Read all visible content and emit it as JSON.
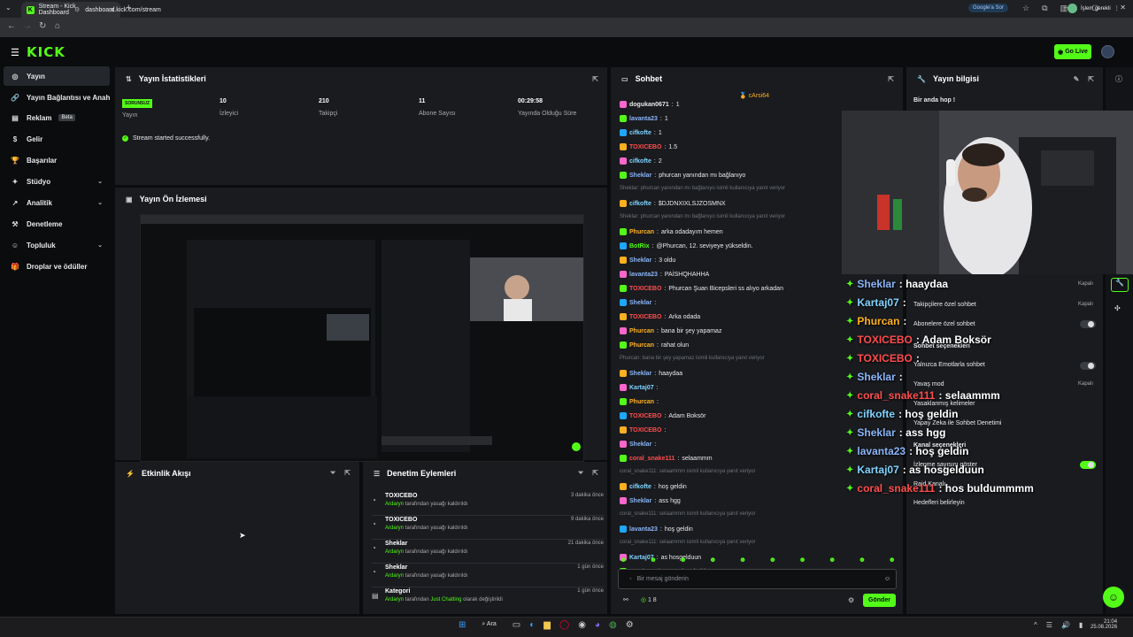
{
  "browser": {
    "tab_title": "Stream - Kick Dashboard",
    "url": "dashboard.kick.com/stream",
    "google_btn": "Google'a Sor",
    "paused": "İşlem gerekli"
  },
  "header": {
    "logo": "KICK",
    "go_live": "Go Live"
  },
  "sidebar": {
    "items": [
      {
        "label": "Yayın",
        "icon": "radio-icon"
      },
      {
        "label": "Yayın Bağlantısı ve Anahtarı",
        "icon": "link-icon"
      },
      {
        "label": "Reklam",
        "icon": "ad-icon",
        "badge": "Beta"
      },
      {
        "label": "Gelir",
        "icon": "money-icon"
      },
      {
        "label": "Başarılar",
        "icon": "trophy-icon"
      },
      {
        "label": "Stüdyo",
        "icon": "studio-icon"
      },
      {
        "label": "Analitik",
        "icon": "chart-icon"
      },
      {
        "label": "Denetleme",
        "icon": "hammer-icon"
      },
      {
        "label": "Topluluk",
        "icon": "community-icon"
      },
      {
        "label": "Droplar ve ödüller",
        "icon": "gift-icon"
      }
    ]
  },
  "stats": {
    "title": "Yayın İstatistikleri",
    "status_badge": "SORUNSUZ",
    "status_label": "Yayın",
    "items": [
      {
        "value": "10",
        "label": "İzleyici"
      },
      {
        "value": "210",
        "label": "Takipçi"
      },
      {
        "value": "11",
        "label": "Abone Sayısı"
      },
      {
        "value": "00:29:58",
        "label": "Yayında Olduğu Süre"
      }
    ],
    "success": "Stream started successfully."
  },
  "preview": {
    "title": "Yayın Ön İzlemesi"
  },
  "activity": {
    "title": "Etkinlik Akışı"
  },
  "mod_actions": {
    "title": "Denetim Eylemleri",
    "items": [
      {
        "name": "TOXICEBO",
        "by": "Ardaryn",
        "text": "tarafından yasağı kaldırıldı",
        "time": "3 dakika önce"
      },
      {
        "name": "TOXICEBO",
        "by": "Ardaryn",
        "text": "tarafından yasağı kaldırıldı",
        "time": "9 dakika önce"
      },
      {
        "name": "Sheklar",
        "by": "Ardaryn",
        "text": "tarafından yasağı kaldırıldı",
        "time": "21 dakika önce"
      },
      {
        "name": "Sheklar",
        "by": "Ardaryn",
        "text": "tarafından yasağı kaldırıldı",
        "time": "1 gün önce"
      },
      {
        "name": "Kategori",
        "by": "Ardaryn",
        "text": "tarafından",
        "extra": "Just Chatting",
        "text2": "olarak değiştirildi",
        "time": "1 gün önce"
      }
    ]
  },
  "chat": {
    "title": "Sohbet",
    "pinned": "cArsi64",
    "messages": [
      {
        "user": "dogukan0671",
        "text": "1",
        "color": "#e7e9ea"
      },
      {
        "user": "lavanta23",
        "text": "1",
        "color": "#8ab4f8"
      },
      {
        "user": "cifkofte",
        "text": "1",
        "color": "#7fd3ff"
      },
      {
        "user": "TOXICEBO",
        "text": "1.5",
        "color": "#ff4d4d"
      },
      {
        "user": "cifkofte",
        "text": "2",
        "color": "#7fd3ff"
      },
      {
        "user": "Sheklar",
        "text": "phurcan yanından mı bağlanıyo",
        "color": "#8ab4f8"
      },
      {
        "sys": "Sheklar: phurcan yanından mı bağlanıyo isimli kullanıcıya yanıt veriyor"
      },
      {
        "user": "cifkofte",
        "text": "$DJDNXIXLSJZOSMNX",
        "color": "#7fd3ff"
      },
      {
        "sys": "Sheklar: phurcan yanından mı bağlanıyo isimli kullanıcıya yanıt veriyor"
      },
      {
        "user": "Phurcan",
        "text": "arka odadayım hemen",
        "color": "#ffb020"
      },
      {
        "user": "BotRix",
        "text": "@Phurcan, 12. seviyeye yükseldin.",
        "color": "#53fc18"
      },
      {
        "user": "Sheklar",
        "text": "3 oldu",
        "color": "#8ab4f8"
      },
      {
        "user": "lavanta23",
        "text": "PAİSHQHAHHA",
        "color": "#8ab4f8"
      },
      {
        "user": "TOXICEBO",
        "text": "Phurcan Şuan Bicepsleri ss alıyo arkadan",
        "color": "#ff4d4d"
      },
      {
        "user": "Sheklar",
        "text": "",
        "color": "#8ab4f8"
      },
      {
        "user": "TOXICEBO",
        "text": "Arka odada",
        "color": "#ff4d4d"
      },
      {
        "user": "Phurcan",
        "text": "bana bir şey yapamaz",
        "color": "#ffb020"
      },
      {
        "user": "Phurcan",
        "text": "rahat olun",
        "color": "#ffb020"
      },
      {
        "sys": "Phurcan: bana bir şey yapamaz isimli kullanıcıya yanıt veriyor"
      },
      {
        "user": "Sheklar",
        "text": "haaydaa",
        "color": "#8ab4f8"
      },
      {
        "user": "Kartaj07",
        "text": "",
        "color": "#7fd3ff"
      },
      {
        "user": "Phurcan",
        "text": "",
        "color": "#ffb020"
      },
      {
        "user": "TOXICEBO",
        "text": "Adam Boksör",
        "color": "#ff4d4d"
      },
      {
        "user": "TOXICEBO",
        "text": "",
        "color": "#ff4d4d"
      },
      {
        "user": "Sheklar",
        "text": "",
        "color": "#8ab4f8"
      },
      {
        "user": "coral_snake111",
        "text": "selaammm",
        "color": "#ff4d4d"
      },
      {
        "sys": "coral_snake111: selaammm isimli kullanıcıya yanıt veriyor"
      },
      {
        "user": "cifkofte",
        "text": "hoş geldin",
        "color": "#7fd3ff"
      },
      {
        "user": "Sheklar",
        "text": "ass hgg",
        "color": "#8ab4f8"
      },
      {
        "sys": "coral_snake111: selaammm isimli kullanıcıya yanıt veriyor"
      },
      {
        "user": "lavanta23",
        "text": "hoş geldin",
        "color": "#8ab4f8"
      },
      {
        "sys": "coral_snake111: selaammm isimli kullanıcıya yanıt veriyor"
      },
      {
        "user": "Kartaj07",
        "text": "as hosgelduun",
        "color": "#7fd3ff"
      },
      {
        "user": "coral_snake111",
        "text": "hos buldummmm",
        "color": "#ff4d4d"
      }
    ],
    "input_placeholder": "Bir mesaj gönderin",
    "viewer_count": "1 8",
    "send": "Gönder"
  },
  "info": {
    "title": "Yayın bilgisi",
    "stream_title": "Bir anda hop !"
  },
  "overlay": [
    {
      "user": "Sheklar",
      "text": ": haaydaa",
      "color": "#8ab4f8"
    },
    {
      "user": "Kartaj07",
      "text": ":",
      "color": "#7fd3ff"
    },
    {
      "user": "Phurcan",
      "text": ":",
      "color": "#ffb020"
    },
    {
      "user": "TOXICEBO",
      "text": ": Adam Boksör",
      "color": "#ff4d4d"
    },
    {
      "user": "TOXICEBO",
      "text": ":",
      "color": "#ff4d4d"
    },
    {
      "user": "Sheklar",
      "text": ":",
      "color": "#8ab4f8"
    },
    {
      "user": "coral_snake111",
      "text": ": selaammm",
      "color": "#ff4d4d"
    },
    {
      "user": "cifkofte",
      "text": ": hoş geldin",
      "color": "#7fd3ff"
    },
    {
      "user": "Sheklar",
      "text": ": ass hgg",
      "color": "#8ab4f8"
    },
    {
      "user": "lavanta23",
      "text": ": hoş geldin",
      "color": "#8ab4f8"
    },
    {
      "user": "Kartaj07",
      "text": ": as hosgelduun",
      "color": "#7fd3ff"
    },
    {
      "user": "coral_snake111",
      "text": ": hos buldummmm",
      "color": "#ff4d4d"
    }
  ],
  "settings": {
    "items": [
      {
        "label": "Takipçilere özel sohbet",
        "value": "Kapalı"
      },
      {
        "label": "Abonelere özel sohbet",
        "value": ""
      },
      {
        "label": "Sohbet seçenekleri",
        "value": ""
      },
      {
        "label": "Yalnızca Emotlarla sohbet",
        "value": ""
      },
      {
        "label": "Yavaş mod",
        "value": "Kapalı"
      },
      {
        "label": "Yasaklanmış kelimeler",
        "value": ""
      },
      {
        "label": "Yapay Zeka ile Sohbet Denetimi",
        "value": ""
      },
      {
        "label": "Kanal seçenekleri",
        "value": ""
      },
      {
        "label": "İzlenme sayısını göster",
        "value": ""
      },
      {
        "label": "Raid Kanalı",
        "value": ""
      },
      {
        "label": "Hedefleri belirleyin",
        "value": ""
      }
    ],
    "first_value": "Kapalı"
  },
  "taskbar": {
    "search": "Ara",
    "time": "21:04",
    "date": "25.08.2026"
  }
}
